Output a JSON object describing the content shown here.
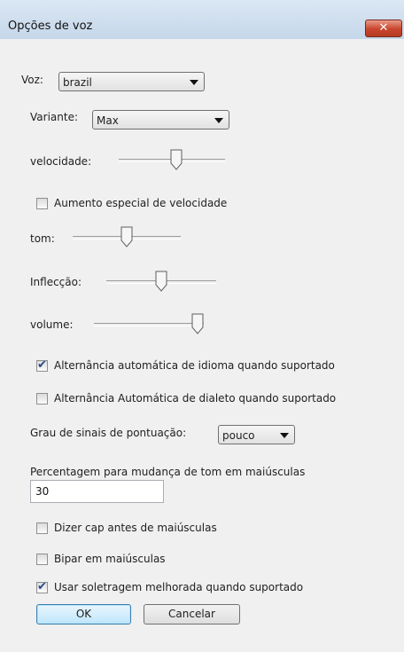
{
  "window": {
    "title": "Opções de voz",
    "close_glyph": "✕"
  },
  "voice": {
    "label": "Voz:",
    "selected": "brazil"
  },
  "variant": {
    "label": "Variante:",
    "selected": "Max"
  },
  "speed": {
    "label": "velocidade:",
    "level": 0.55
  },
  "speed_boost": {
    "label": "Aumento especial de velocidade",
    "checked": false
  },
  "pitch": {
    "label": "tom:",
    "level": 0.5
  },
  "inflection": {
    "label": "Inflecção:",
    "level": 0.5
  },
  "volume": {
    "label": "volume:",
    "level": 1.0
  },
  "auto_language": {
    "label": "Alternância automática de idioma quando suportado",
    "checked": true
  },
  "auto_dialect": {
    "label": "Alternância Automática de dialeto quando suportado",
    "checked": false
  },
  "punctuation": {
    "label": "Grau de sinais de pontuação:",
    "selected": "pouco"
  },
  "cap_pitch": {
    "label": "Percentagem para mudança de tom em maiúsculas",
    "value": "30"
  },
  "say_cap": {
    "label": "Dizer cap antes de maiúsculas",
    "checked": false
  },
  "beep_caps": {
    "label": "Bipar em maiúsculas",
    "checked": false
  },
  "spelling": {
    "label": "Usar soletragem melhorada quando suportado",
    "checked": true
  },
  "buttons": {
    "ok": "OK",
    "cancel": "Cancelar"
  },
  "icons": {
    "check": "✔",
    "close": "close-icon",
    "dropdown": "chevron-down-icon",
    "slider_thumb": "slider-thumb-icon"
  }
}
